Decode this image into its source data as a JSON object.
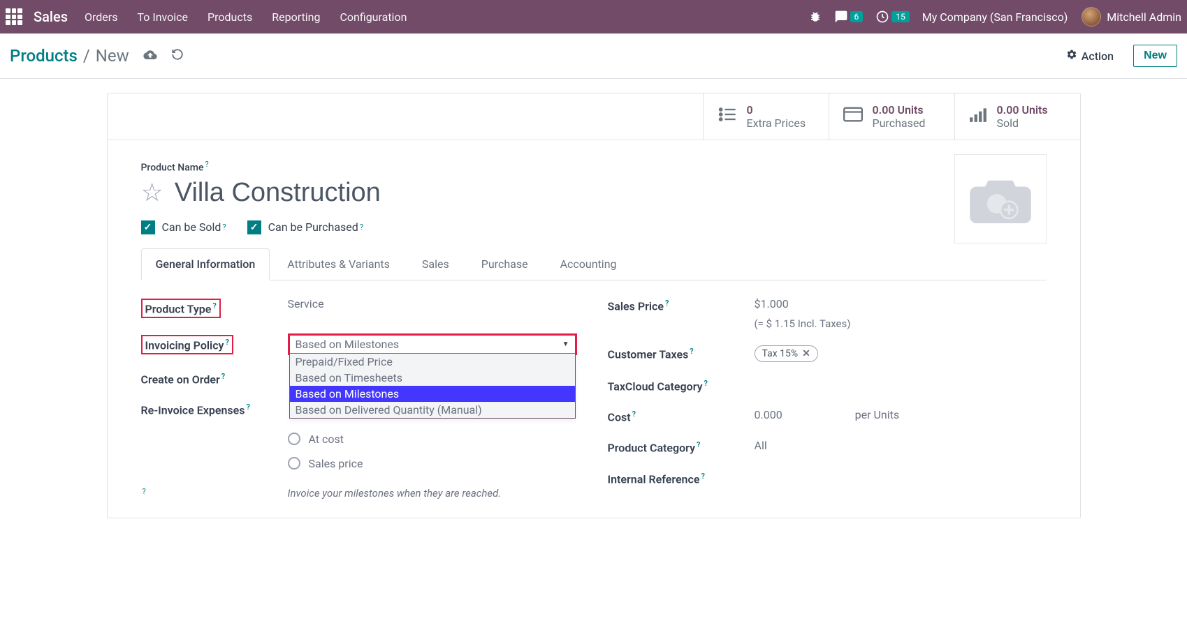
{
  "nav": {
    "app": "Sales",
    "links": [
      "Orders",
      "To Invoice",
      "Products",
      "Reporting",
      "Configuration"
    ],
    "chat_badge": "6",
    "activity_badge": "15",
    "company": "My Company (San Francisco)",
    "user": "Mitchell Admin"
  },
  "breadcrumb": {
    "parent": "Products",
    "current": "New"
  },
  "actions": {
    "action_label": "Action",
    "new_label": "New"
  },
  "stats": {
    "extra_prices": {
      "value": "0",
      "label": "Extra Prices"
    },
    "purchased": {
      "value": "0.00 Units",
      "label": "Purchased"
    },
    "sold": {
      "value": "0.00 Units",
      "label": "Sold"
    }
  },
  "product": {
    "name_label": "Product Name",
    "name_value": "Villa Construction",
    "can_be_sold": "Can be Sold",
    "can_be_purchased": "Can be Purchased"
  },
  "tabs": [
    "General Information",
    "Attributes & Variants",
    "Sales",
    "Purchase",
    "Accounting"
  ],
  "left": {
    "product_type_label": "Product Type",
    "product_type_value": "Service",
    "invoicing_policy_label": "Invoicing Policy",
    "invoicing_policy_selected": "Based on Milestones",
    "invoicing_policy_options": [
      "Prepaid/Fixed Price",
      "Based on Timesheets",
      "Based on Milestones",
      "Based on Delivered Quantity (Manual)"
    ],
    "create_on_order_label": "Create on Order",
    "reinvoice_label": "Re-Invoice Expenses",
    "radio_at_cost": "At cost",
    "radio_sales_price": "Sales price",
    "helper": "Invoice your milestones when they are reached."
  },
  "right": {
    "sales_price_label": "Sales Price",
    "sales_price_value": "$1.000",
    "sales_price_incl": "(= $ 1.15 Incl. Taxes)",
    "customer_taxes_label": "Customer Taxes",
    "tax_tag": "Tax 15%",
    "taxcloud_label": "TaxCloud Category",
    "cost_label": "Cost",
    "cost_value": "0.000",
    "cost_unit": "per Units",
    "product_category_label": "Product Category",
    "product_category_value": "All",
    "internal_ref_label": "Internal Reference"
  }
}
